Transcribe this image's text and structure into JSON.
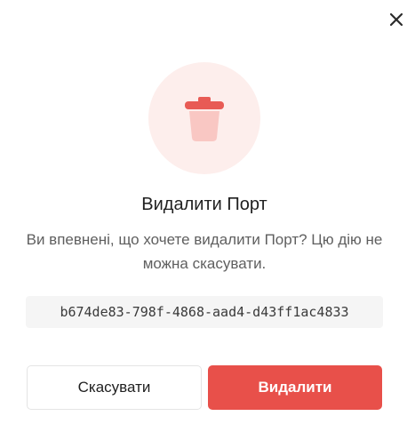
{
  "dialog": {
    "title": "Видалити Порт",
    "message": "Ви впевнені, що хочете видалити Порт? Цю дію не можна скасувати.",
    "item_id": "b674de83-798f-4868-aad4-d43ff1ac4833",
    "cancel_label": "Скасувати",
    "delete_label": "Видалити",
    "icons": {
      "close": "close-icon",
      "trash": "trash-icon"
    },
    "colors": {
      "danger": "#e8504a",
      "icon_bg": "#fdeeec",
      "trash_lid": "#e85b55",
      "trash_body": "#f9c7c3"
    }
  }
}
